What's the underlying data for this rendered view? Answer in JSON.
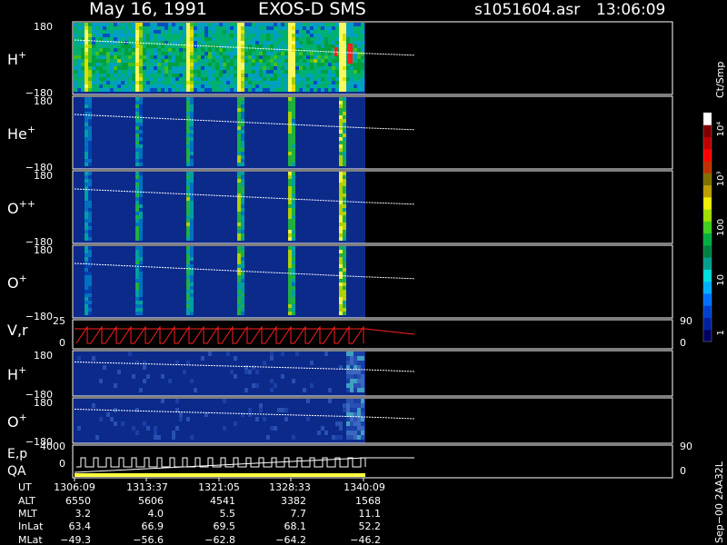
{
  "header": {
    "date": "May 16, 1991",
    "mission": "EXOS-D SMS",
    "file": "s1051604.asr",
    "time": "13:06:09"
  },
  "colors": {
    "background": "#000000",
    "frame": "#ffffff",
    "trace_white": "#ffffff",
    "trace_red": "#ff2020",
    "qa_bar": "#ffff40",
    "fill_base": "#0b2a8a"
  },
  "colorbar": {
    "unit_label": "Ct/Smp",
    "tick_labels": [
      "1",
      "10",
      "100",
      "10³",
      "10⁴"
    ],
    "tick_values": [
      1,
      10,
      100,
      1000,
      10000
    ],
    "scale": "log",
    "colors": [
      "#000060",
      "#0020a0",
      "#0040d0",
      "#0070ff",
      "#00b0ff",
      "#00e0e0",
      "#00a090",
      "#008040",
      "#00b040",
      "#40d020",
      "#a0e000",
      "#f0f000",
      "#c0a000",
      "#807000",
      "#c03000",
      "#ff0000",
      "#c00000",
      "#800000",
      "#ffffff"
    ]
  },
  "chart_data": [
    {
      "type": "heatmap",
      "panel": "H+",
      "ylabel": "H+",
      "yticks": [
        "180",
        "−180"
      ],
      "ylim": [
        -180,
        180
      ],
      "note": "pitch angle vs time spectrogram"
    },
    {
      "type": "heatmap",
      "panel": "He+",
      "ylabel": "He+",
      "yticks": [
        "180",
        "−180"
      ],
      "ylim": [
        -180,
        180
      ]
    },
    {
      "type": "heatmap",
      "panel": "O++",
      "ylabel": "O++",
      "yticks": [
        "180",
        "−180"
      ],
      "ylim": [
        -180,
        180
      ]
    },
    {
      "type": "heatmap",
      "panel": "O+",
      "ylabel": "O+",
      "yticks": [
        "180",
        "−180"
      ],
      "ylim": [
        -180,
        180
      ]
    },
    {
      "type": "line",
      "panel": "V,r",
      "ylabel": "V,r",
      "yticks_left": [
        "25",
        "0"
      ],
      "yticks_right": [
        "90",
        "0"
      ],
      "ylim": [
        0,
        25
      ]
    },
    {
      "type": "heatmap",
      "panel": "H+ (2)",
      "ylabel": "H+",
      "yticks": [
        "180",
        "−180"
      ],
      "ylim": [
        -180,
        180
      ]
    },
    {
      "type": "heatmap",
      "panel": "O+ (2)",
      "ylabel": "O+",
      "yticks": [
        "180",
        "−180"
      ],
      "ylim": [
        -180,
        180
      ]
    },
    {
      "type": "line",
      "panel": "E,p QA",
      "ylabel_top": "E,p",
      "ylabel_bottom": "QA",
      "yticks_left": [
        "4000",
        "0"
      ],
      "yticks_right": [
        "90",
        "0"
      ],
      "ylim": [
        0,
        4000
      ]
    }
  ],
  "ephemeris": {
    "row_labels": [
      "UT",
      "ALT",
      "MLT",
      "InLat",
      "MLat"
    ],
    "columns": [
      [
        "1306:09",
        "6550",
        "3.2",
        "63.4",
        "−49.3"
      ],
      [
        "1313:37",
        "5606",
        "4.0",
        "66.9",
        "−56.6"
      ],
      [
        "1321:05",
        "4541",
        "5.5",
        "69.5",
        "−62.8"
      ],
      [
        "1328:33",
        "3382",
        "7.7",
        "68.1",
        "−64.2"
      ],
      [
        "1340:09",
        "1568",
        "11.1",
        "52.2",
        "−46.2"
      ]
    ]
  },
  "footer": {
    "stamp": "Sep−00  2AA32L"
  }
}
